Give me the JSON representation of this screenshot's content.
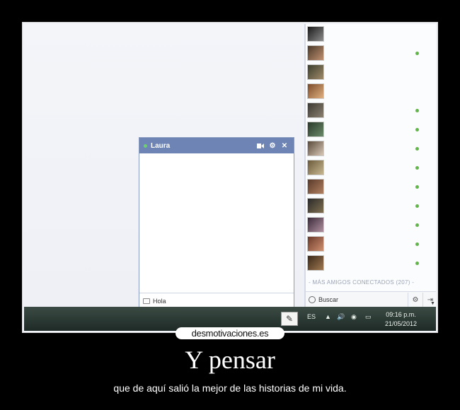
{
  "chat": {
    "name": "Laura",
    "input_text": "Hola",
    "icons": [
      "video-icon",
      "gear-icon",
      "close-icon"
    ]
  },
  "sidebar": {
    "friends": [
      {
        "color_a": "#1a1a1a",
        "color_b": "#8c8c8c",
        "online": false
      },
      {
        "color_a": "#4a3a2a",
        "color_b": "#c09070",
        "online": true
      },
      {
        "color_a": "#3b3f2e",
        "color_b": "#a08a6a",
        "online": false
      },
      {
        "color_a": "#7b4b2a",
        "color_b": "#e0b080",
        "online": false
      },
      {
        "color_a": "#3c3a33",
        "color_b": "#8a8070",
        "online": true
      },
      {
        "color_a": "#2a3a2a",
        "color_b": "#6a8a6a",
        "online": true
      },
      {
        "color_a": "#5a4a3a",
        "color_b": "#d8c8b8",
        "online": true
      },
      {
        "color_a": "#6a5a3a",
        "color_b": "#c8b890",
        "online": true
      },
      {
        "color_a": "#5a3a2a",
        "color_b": "#b08060",
        "online": true
      },
      {
        "color_a": "#2a2a2a",
        "color_b": "#807050",
        "online": true
      },
      {
        "color_a": "#3a2a3a",
        "color_b": "#b090a0",
        "online": true
      },
      {
        "color_a": "#6a3a2a",
        "color_b": "#d09070",
        "online": true
      },
      {
        "color_a": "#3a2a1a",
        "color_b": "#a07850",
        "online": true
      }
    ],
    "more_label": "- MÁS AMIGOS CONECTADOS (207) -",
    "search_label": "Buscar"
  },
  "taskbar": {
    "language": "ES",
    "time": "09:16 p.m.",
    "date": "21/05/2012"
  },
  "brand": "desmotivaciones.es",
  "caption": {
    "title": "Y pensar",
    "subtitle": "que de aquí salió la mejor de las historias de mi vida."
  }
}
